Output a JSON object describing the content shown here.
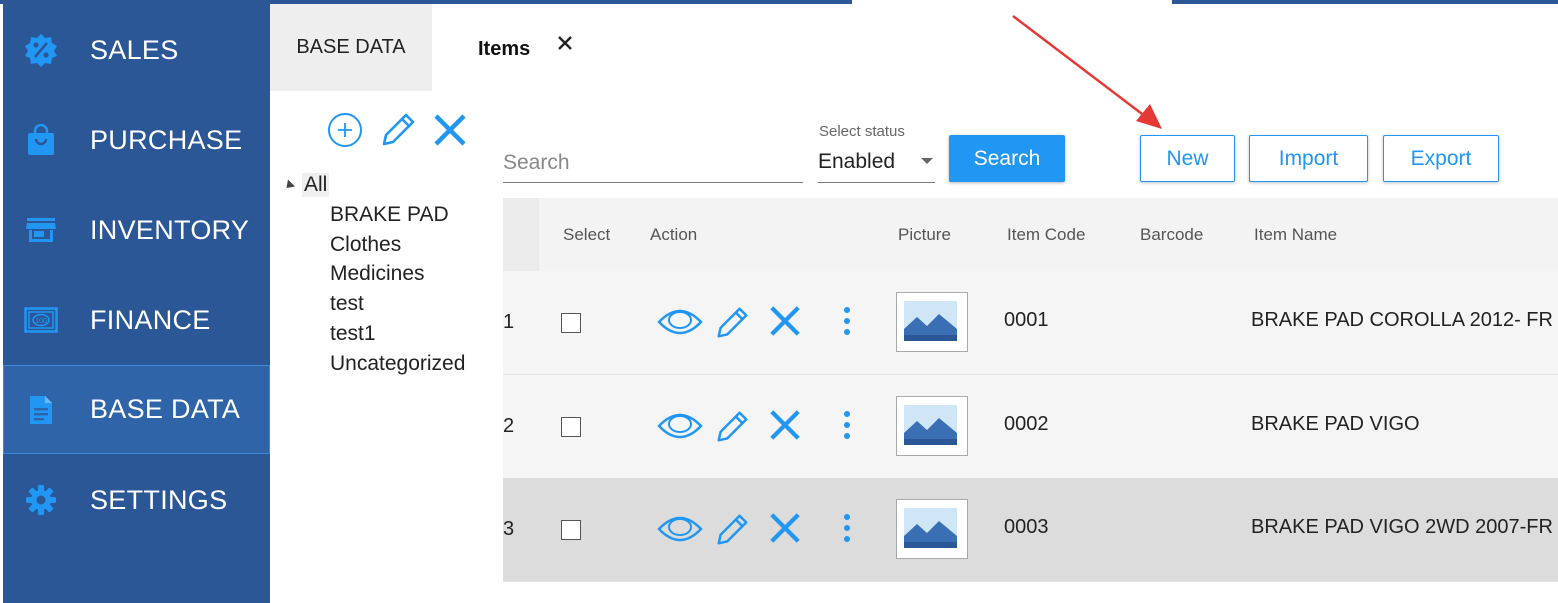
{
  "sidebar": {
    "items": [
      {
        "label": "SALES",
        "icon": "percent-badge-icon"
      },
      {
        "label": "PURCHASE",
        "icon": "shopping-bag-icon"
      },
      {
        "label": "INVENTORY",
        "icon": "store-icon"
      },
      {
        "label": "FINANCE",
        "icon": "banknote-icon"
      },
      {
        "label": "BASE DATA",
        "icon": "document-icon"
      },
      {
        "label": "SETTINGS",
        "icon": "gear-icon"
      }
    ],
    "active": "BASE DATA"
  },
  "tabs": {
    "base_data": "BASE DATA",
    "items": "Items"
  },
  "tree": {
    "root": "All",
    "children": [
      "BRAKE PAD",
      "Clothes",
      "Medicines",
      "test",
      "test1",
      "Uncategorized"
    ]
  },
  "toolbar": {
    "search_placeholder": "Search",
    "status_label": "Select status",
    "status_value": "Enabled",
    "search_button": "Search",
    "new_button": "New",
    "import_button": "Import",
    "export_button": "Export"
  },
  "table": {
    "columns": {
      "select": "Select",
      "action": "Action",
      "picture": "Picture",
      "item_code": "Item Code",
      "barcode": "Barcode",
      "item_name": "Item Name"
    },
    "rows": [
      {
        "num": "1",
        "code": "0001",
        "barcode": "",
        "name": "BRAKE PAD COROLLA 2012- FR"
      },
      {
        "num": "2",
        "code": "0002",
        "barcode": "",
        "name": "BRAKE PAD VIGO"
      },
      {
        "num": "3",
        "code": "0003",
        "barcode": "",
        "name": "BRAKE PAD VIGO 2WD 2007-FR"
      }
    ]
  },
  "colors": {
    "sidebar": "#2b5797",
    "accent": "#2196f3",
    "annotation_arrow": "#e53935"
  }
}
